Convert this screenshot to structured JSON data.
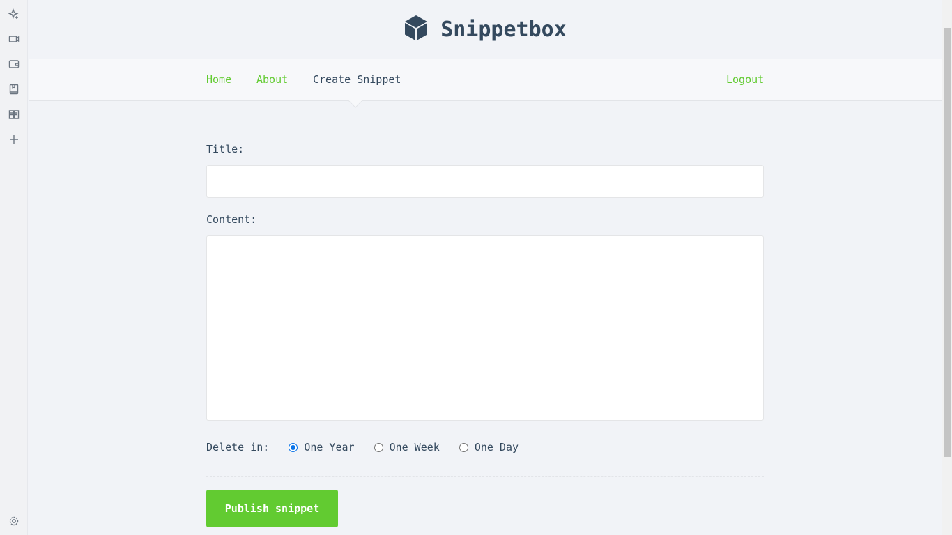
{
  "app": {
    "title": "Snippetbox"
  },
  "nav": {
    "home": "Home",
    "about": "About",
    "create": "Create Snippet",
    "logout": "Logout"
  },
  "form": {
    "title_label": "Title:",
    "title_value": "",
    "content_label": "Content:",
    "content_value": "",
    "delete_label": "Delete in:",
    "options": [
      {
        "label": "One Year",
        "checked": true
      },
      {
        "label": "One Week",
        "checked": false
      },
      {
        "label": "One Day",
        "checked": false
      }
    ],
    "submit": "Publish snippet"
  },
  "colors": {
    "accent": "#62cb31",
    "text": "#34495e",
    "radio": "#0b74e8"
  },
  "sidebar": {
    "icons": [
      "sparkle-icon",
      "video-icon",
      "wallet-icon",
      "bookmark-book-icon",
      "reader-icon",
      "plus-icon",
      "gear-icon"
    ]
  }
}
